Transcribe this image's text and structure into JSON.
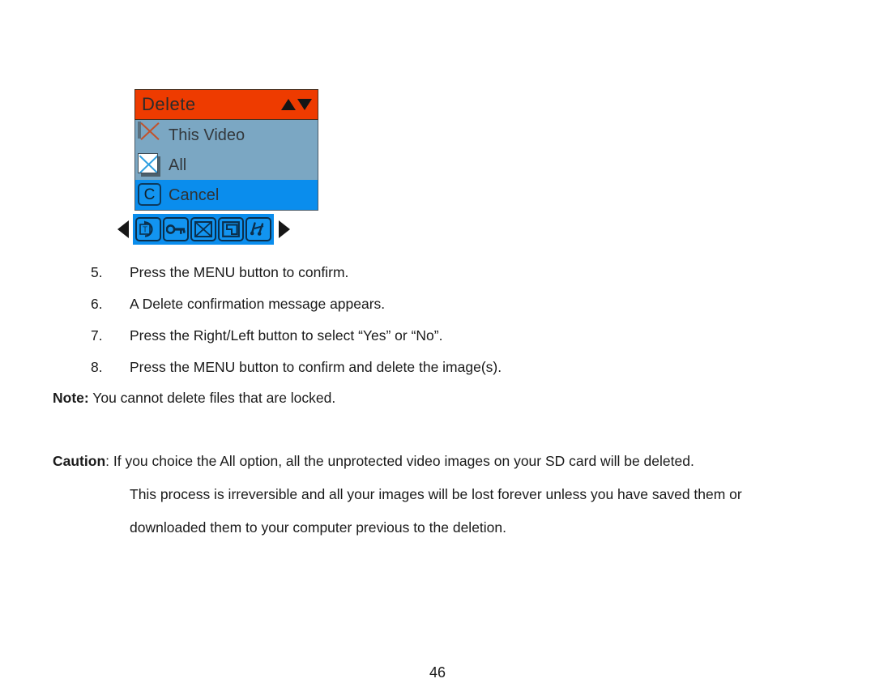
{
  "camera_screen": {
    "title": "Delete",
    "title_arrows": [
      "triangle-up",
      "triangle-down"
    ],
    "colors": {
      "title_bar": "#ee3b00",
      "list_background": "#7ba7c3",
      "selected_row": "#0a8ded",
      "toolbar": "#0a8ded"
    },
    "menu_items": [
      {
        "label": "This Video",
        "icon": "delete-single-x-icon",
        "selected": false
      },
      {
        "label": "All",
        "icon": "delete-all-pages-x-icon",
        "selected": false
      },
      {
        "label": "Cancel",
        "icon": "cancel-c-icon",
        "selected": true
      }
    ],
    "toolbar_icons": [
      "rotate-text-icon",
      "protect-key-icon",
      "delete-x-icon",
      "resize-square-icon",
      "effect-startup-icon"
    ],
    "nav_left": "triangle-left",
    "nav_right": "triangle-right"
  },
  "steps": [
    {
      "number": "5.",
      "text": "Press the MENU button to confirm."
    },
    {
      "number": "6.",
      "text": "A Delete confirmation message appears."
    },
    {
      "number": "7.",
      "text": "Press the Right/Left button to select “Yes” or “No”."
    },
    {
      "number": "8.",
      "text": "Press the MENU button to confirm and delete the image(s)."
    }
  ],
  "note": {
    "label": "Note:",
    "text": " You cannot delete files that are locked."
  },
  "caution": {
    "label": "Caution",
    "first_line": ": If you choice the All option, all the unprotected video images on your SD card will be deleted.",
    "continuation_lines": [
      "This process is irreversible and all your images will be lost forever unless you have saved them or",
      "downloaded them to your computer previous to the deletion."
    ]
  },
  "page_number": "46"
}
